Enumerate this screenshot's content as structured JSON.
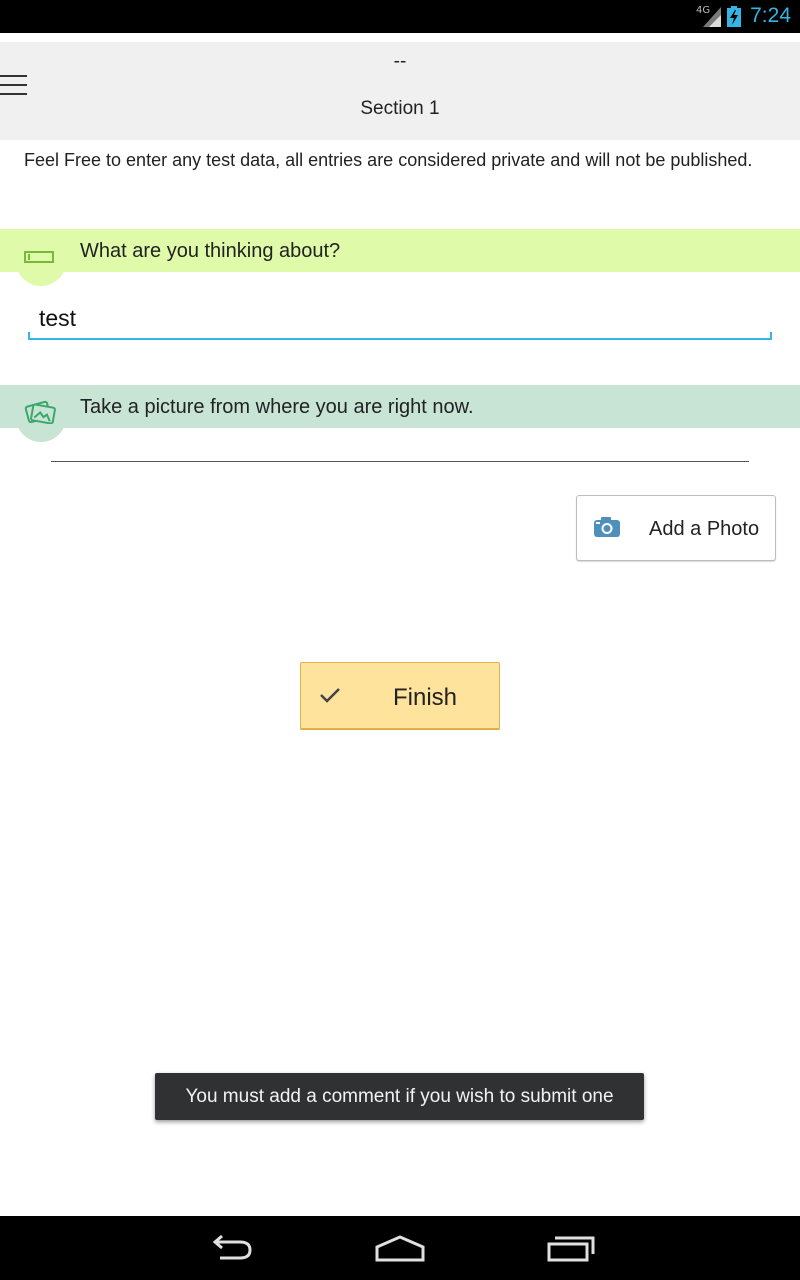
{
  "status_bar": {
    "network": "4G",
    "time": "7:24",
    "icons": [
      "signal-icon",
      "battery-charging-icon"
    ],
    "time_color": "#33b5e5"
  },
  "header": {
    "title": "--",
    "subtitle": "Section 1",
    "menu_icon": "hamburger-menu-icon"
  },
  "intro_text": "Feel Free to enter any test data, all entries are considered private and will not be published.",
  "questions": [
    {
      "text": "What are you thinking about?",
      "icon": "text-field-icon",
      "band_color": "#dffaa8",
      "answer": "test"
    },
    {
      "text": "Take a picture from where you are right now.",
      "icon": "photos-icon",
      "band_color": "#c7e4d4"
    }
  ],
  "add_photo": {
    "label": "Add a Photo",
    "icon": "camera-icon"
  },
  "finish": {
    "label": "Finish",
    "icon": "checkmark-icon",
    "color": "#fde39c"
  },
  "toast": {
    "message": "You must add a comment if you wish to submit one"
  },
  "nav_bar": {
    "buttons": [
      "back-icon",
      "home-icon",
      "recent-apps-icon"
    ]
  }
}
